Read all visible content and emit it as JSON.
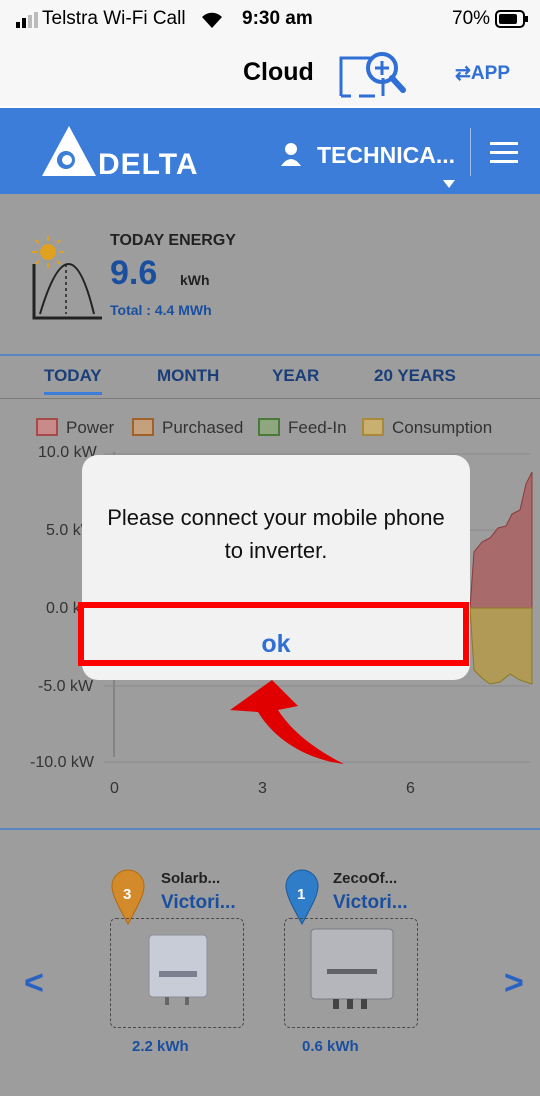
{
  "status_bar": {
    "carrier": "Telstra Wi-Fi Call",
    "time": "9:30 am",
    "battery": "70%"
  },
  "nav": {
    "title": "Cloud",
    "app_link": "⇄APP"
  },
  "header": {
    "brand": "DELTA",
    "user": "TECHNICA..."
  },
  "energy": {
    "label": "TODAY ENERGY",
    "value": "9.6",
    "unit": "kWh",
    "total": "Total : 4.4 MWh"
  },
  "tabs": [
    "TODAY",
    "MONTH",
    "YEAR",
    "20 YEARS"
  ],
  "legend": [
    "Power",
    "Purchased",
    "Feed-In",
    "Consumption"
  ],
  "chart_data": {
    "type": "area",
    "y_ticks": [
      "10.0 kW",
      "5.0 kW",
      "0.0 kW",
      "-5.0 kW",
      "-10.0 kW"
    ],
    "x_ticks": [
      "0",
      "3",
      "6"
    ],
    "series": [
      {
        "name": "Power",
        "color": "#c98a8a"
      },
      {
        "name": "Consumption",
        "color": "#c9b070"
      }
    ]
  },
  "stations": [
    {
      "badge": "3",
      "name": "Solarb...",
      "sub": "Victori...",
      "energy": "2.2 kWh",
      "color": "#d28a2a"
    },
    {
      "badge": "1",
      "name": "ZecoOf...",
      "sub": "Victori...",
      "energy": "0.6 kWh",
      "color": "#2f7cc9"
    }
  ],
  "nav_arrows": {
    "prev": "<",
    "next": ">"
  },
  "dialog": {
    "message": "Please connect your mobile phone to inverter.",
    "ok": "ok"
  },
  "colors": {
    "header_blue": "#3b7dd8",
    "link_blue": "#2f6fd6",
    "overlay": "#9d9d9d",
    "highlight_red": "#ff0000"
  }
}
